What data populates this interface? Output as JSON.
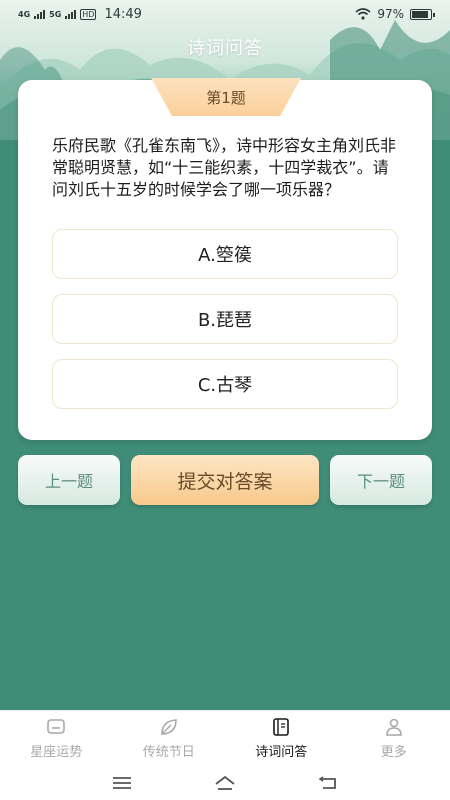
{
  "status_bar": {
    "signal_1": "4G",
    "signal_2": "5G",
    "hd": "HD",
    "time": "14:49",
    "battery": "97%"
  },
  "page": {
    "title": "诗词问答"
  },
  "question": {
    "number": "第1题",
    "text": "乐府民歌《孔雀东南飞》，诗中形容女主角刘氏非常聪明贤慧，如“十三能织素，十四学裁衣”。请问刘氏十五岁的时候学会了哪一项乐器？",
    "options": [
      {
        "label": "A.箜篌"
      },
      {
        "label": "B.琵琶"
      },
      {
        "label": "C.古琴"
      }
    ]
  },
  "actions": {
    "prev": "上一题",
    "submit": "提交对答案",
    "next": "下一题"
  },
  "bottom_nav": {
    "items": [
      {
        "label": "星座运势",
        "icon": "monitor-icon"
      },
      {
        "label": "传统节日",
        "icon": "leaf-icon"
      },
      {
        "label": "诗词问答",
        "icon": "book-icon",
        "active": true
      },
      {
        "label": "更多",
        "icon": "person-icon"
      }
    ]
  },
  "colors": {
    "background": "#3f8c77",
    "accent": "#f8c98c",
    "active_nav": "#1a1a1a",
    "inactive_nav": "#a9a9a9"
  }
}
